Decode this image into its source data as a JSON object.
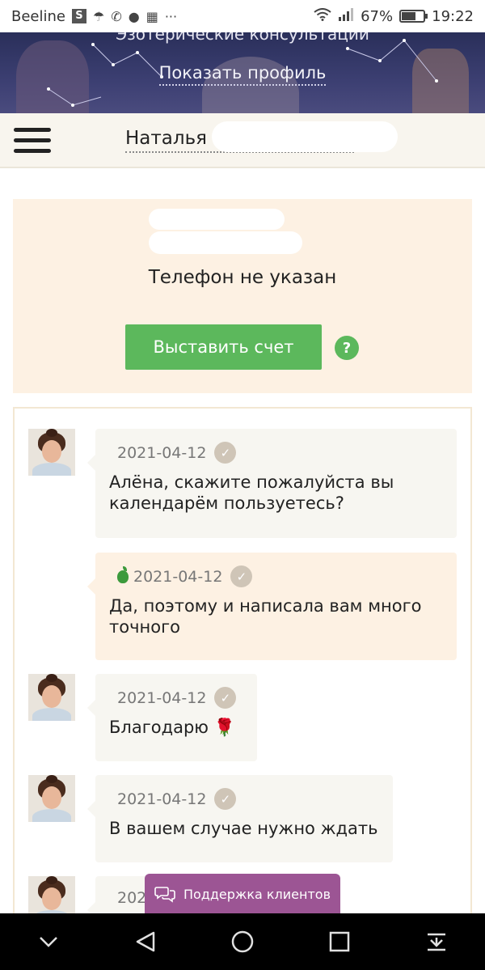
{
  "status_bar": {
    "carrier": "Beeline",
    "battery": "67%",
    "time": "19:22",
    "icons": [
      "sim-s-icon",
      "umbrella-icon",
      "viber-icon",
      "chat-icon",
      "calendar-icon",
      "more-icon",
      "wifi-icon",
      "signal-icon",
      "battery-icon"
    ]
  },
  "header": {
    "subtitle": "Эзотерические консультации",
    "show_profile": "Показать профиль"
  },
  "client": {
    "name": "Наталья"
  },
  "info": {
    "phone_status": "Телефон не указан",
    "invoice_button": "Выставить счет",
    "help": "?"
  },
  "messages": [
    {
      "date": "2021-04-12",
      "text": "Алёна, скажите пожалуйста вы календарём пользуетесь?",
      "from": "client"
    },
    {
      "date": "2021-04-12",
      "text": "Да, поэтому и написала вам много точного",
      "from": "expert"
    },
    {
      "date": "2021-04-12",
      "text": "Благодарю 🌹",
      "from": "client"
    },
    {
      "date": "2021-04-12",
      "text": "В вашем случае нужно ждать",
      "from": "client"
    },
    {
      "date": "202",
      "text": "",
      "from": "client"
    }
  ],
  "support": {
    "label": "Поддержка клиентов"
  },
  "colors": {
    "accent_green": "#5cb85c",
    "support_purple": "#9c5594",
    "card_bg": "#fdf1e3",
    "bubble_bg": "#f7f6f1"
  }
}
